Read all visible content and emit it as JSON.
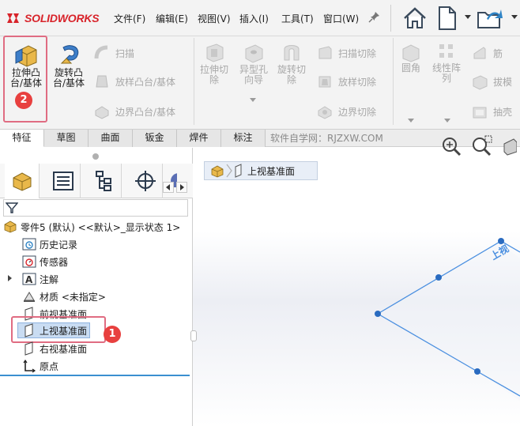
{
  "app": {
    "brand": "SOLIDWORKS",
    "brand_color": "#d8232a"
  },
  "menu": {
    "items": [
      "文件(F)",
      "编辑(E)",
      "视图(V)",
      "插入(I)",
      "工具(T)",
      "窗口(W)"
    ]
  },
  "commands": {
    "extrude_boss": "拉伸凸\n台/基体",
    "revolve_boss": "旋转凸\n台/基体",
    "sweep": "扫描",
    "loft_boss": "放样凸台/基体",
    "boundary_boss": "边界凸台/基体",
    "extrude_cut": "拉伸切\n除",
    "hole_wizard": "异型孔\n向导",
    "revolve_cut": "旋转切\n除",
    "swept_cut": "扫描切除",
    "lofted_cut": "放样切除",
    "boundary_cut": "边界切除",
    "fillet": "圆角",
    "linear_pattern": "线性阵\n列",
    "rib": "筋",
    "draft": "拔模",
    "shell": "抽壳"
  },
  "tabs": [
    "特征",
    "草图",
    "曲面",
    "钣金",
    "焊件",
    "标注"
  ],
  "active_tab": "特征",
  "watermark": "软件自学网：RJZXW.COM",
  "breadcrumb": {
    "label": "上视基准面"
  },
  "feature_tree": {
    "root": "零件5 (默认) <<默认>_显示状态 1>",
    "items": [
      {
        "label": "历史记录",
        "icon": "history-icon"
      },
      {
        "label": "传感器",
        "icon": "sensor-icon"
      },
      {
        "label": "注解",
        "icon": "annotation-icon"
      },
      {
        "label": "材质 <未指定>",
        "icon": "material-icon"
      },
      {
        "label": "前视基准面",
        "icon": "plane-icon"
      },
      {
        "label": "上视基准面",
        "icon": "plane-icon"
      },
      {
        "label": "右视基准面",
        "icon": "plane-icon"
      },
      {
        "label": "原点",
        "icon": "origin-icon"
      }
    ],
    "selected": "上视基准面"
  },
  "annotations": {
    "badge1": "1",
    "badge2": "2",
    "badge_color": "#e8403f"
  },
  "plane_label": "上视",
  "colors": {
    "highlight": "#e06c82",
    "selection": "#c9dcf2",
    "plane_edge": "#4a8fe0"
  }
}
